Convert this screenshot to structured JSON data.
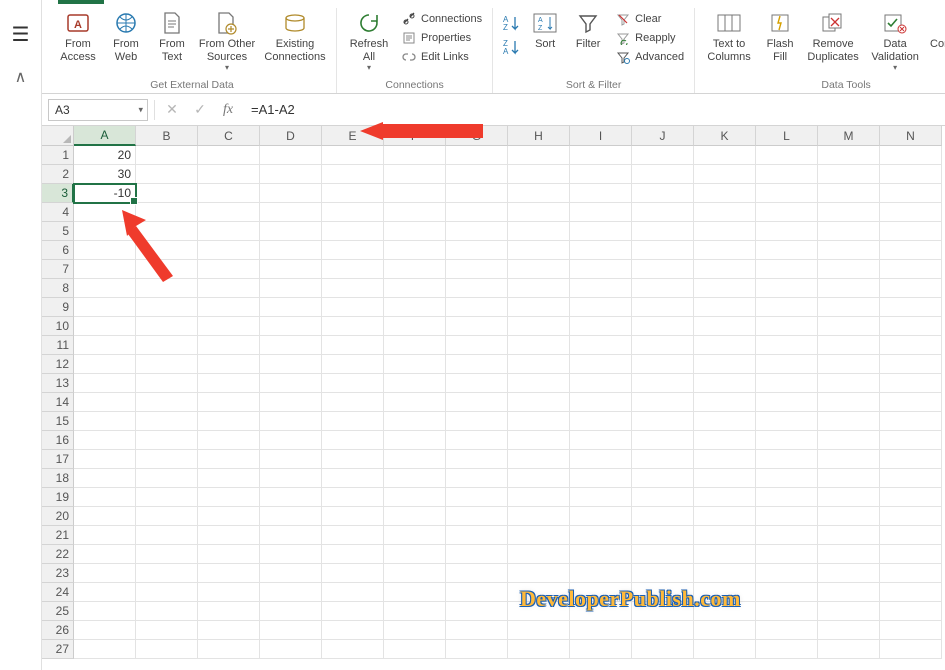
{
  "ribbon": {
    "groups": {
      "get_external_data": {
        "label": "Get External Data",
        "from_access": "From Access",
        "from_web": "From Web",
        "from_text": "From Text",
        "from_other_sources": "From Other Sources",
        "existing_connections": "Existing Connections"
      },
      "connections": {
        "label": "Connections",
        "refresh_all": "Refresh All",
        "connections": "Connections",
        "properties": "Properties",
        "edit_links": "Edit Links"
      },
      "sort_filter": {
        "label": "Sort & Filter",
        "sort": "Sort",
        "filter": "Filter",
        "clear": "Clear",
        "reapply": "Reapply",
        "advanced": "Advanced"
      },
      "data_tools": {
        "label": "Data Tools",
        "text_to_columns": "Text to Columns",
        "flash_fill": "Flash Fill",
        "remove_duplicates": "Remove Duplicates",
        "data_validation": "Data Validation",
        "consolidate": "Consolidate"
      }
    }
  },
  "formula_bar": {
    "name_box": "A3",
    "formula": "=A1-A2",
    "fx_label": "fx"
  },
  "grid": {
    "columns": [
      "A",
      "B",
      "C",
      "D",
      "E",
      "F",
      "G",
      "H",
      "I",
      "J",
      "K",
      "L",
      "M",
      "N"
    ],
    "row_count": 27,
    "active_cell": {
      "row": 3,
      "col": "A"
    },
    "cells": {
      "A1": "20",
      "A2": "30",
      "A3": "-10"
    }
  },
  "watermark": "DeveloperPublish.com",
  "colors": {
    "excel_green": "#217346",
    "arrow_red": "#ef3b2c"
  }
}
